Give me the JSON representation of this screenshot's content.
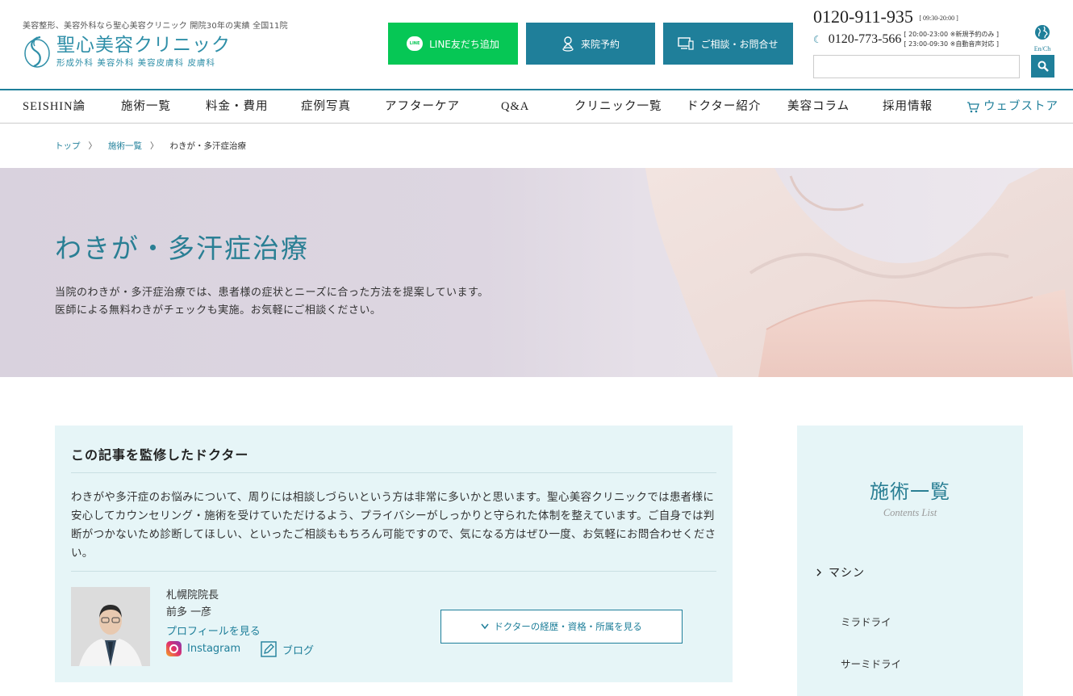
{
  "header": {
    "tagline": "美容整形、美容外科なら聖心美容クリニック 開院30年の実績 全国11院",
    "logo_name": "聖心美容クリニック",
    "logo_sub": "形成外科 美容外科 美容皮膚科 皮膚科",
    "line_badge": "LINE",
    "line_button": "LINE友だち追加",
    "reserve_button": "来院予約",
    "consult_button": "ご相談・お問合せ",
    "phone_main": "0120-911-935",
    "phone_main_hours": "[ 09:30-20:00 ]",
    "phone_night": "0120-773-566",
    "phone_night_note1": "[ 20:00-23:00 ※新規予約のみ ]",
    "phone_night_note2": "[ 23:00-09:30 ※自動音声対応 ]",
    "lang_label": "En/Ch",
    "search_placeholder": ""
  },
  "nav": {
    "items": [
      "SEISHIN論",
      "施術一覧",
      "料金・費用",
      "症例写真",
      "アフターケア",
      "Q&A",
      "クリニック一覧",
      "ドクター紹介",
      "美容コラム",
      "採用情報"
    ],
    "store": "ウェブストア"
  },
  "breadcrumb": {
    "top": "トップ",
    "list": "施術一覧",
    "current": "わきが・多汗症治療",
    "sep": "〉"
  },
  "hero": {
    "title": "わきが・多汗症治療",
    "desc_line1": "当院のわきが・多汗症治療では、患者様の症状とニーズに合った方法を提案しています。",
    "desc_line2": "医師による無料わきがチェックも実施。お気軽にご相談ください。"
  },
  "supervisor": {
    "title": "この記事を監修したドクター",
    "text": "わきがや多汗症のお悩みについて、周りには相談しづらいという方は非常に多いかと思います。聖心美容クリニックでは患者様に安心してカウンセリング・施術を受けていただけるよう、プライバシーがしっかりと守られた体制を整えています。ご自身では判断がつかないため診断してほしい、といったご相談ももちろん可能ですので、気になる方はぜひ一度、お気軽にお問合わせください。",
    "doctor_role": "札幌院院長",
    "doctor_name": "前多 一彦",
    "profile_link": "プロフィールを見る",
    "instagram": "Instagram",
    "blog": "ブログ",
    "career_button": "ドクターの経歴・資格・所属を見る"
  },
  "sidebar": {
    "title": "施術一覧",
    "subtitle": "Contents List",
    "category": "マシン",
    "items": [
      "ミラドライ",
      "サーミドライ"
    ]
  },
  "colors": {
    "accent": "#1f7f9a",
    "line_green": "#06c755",
    "panel_bg": "#e6f5f7"
  }
}
